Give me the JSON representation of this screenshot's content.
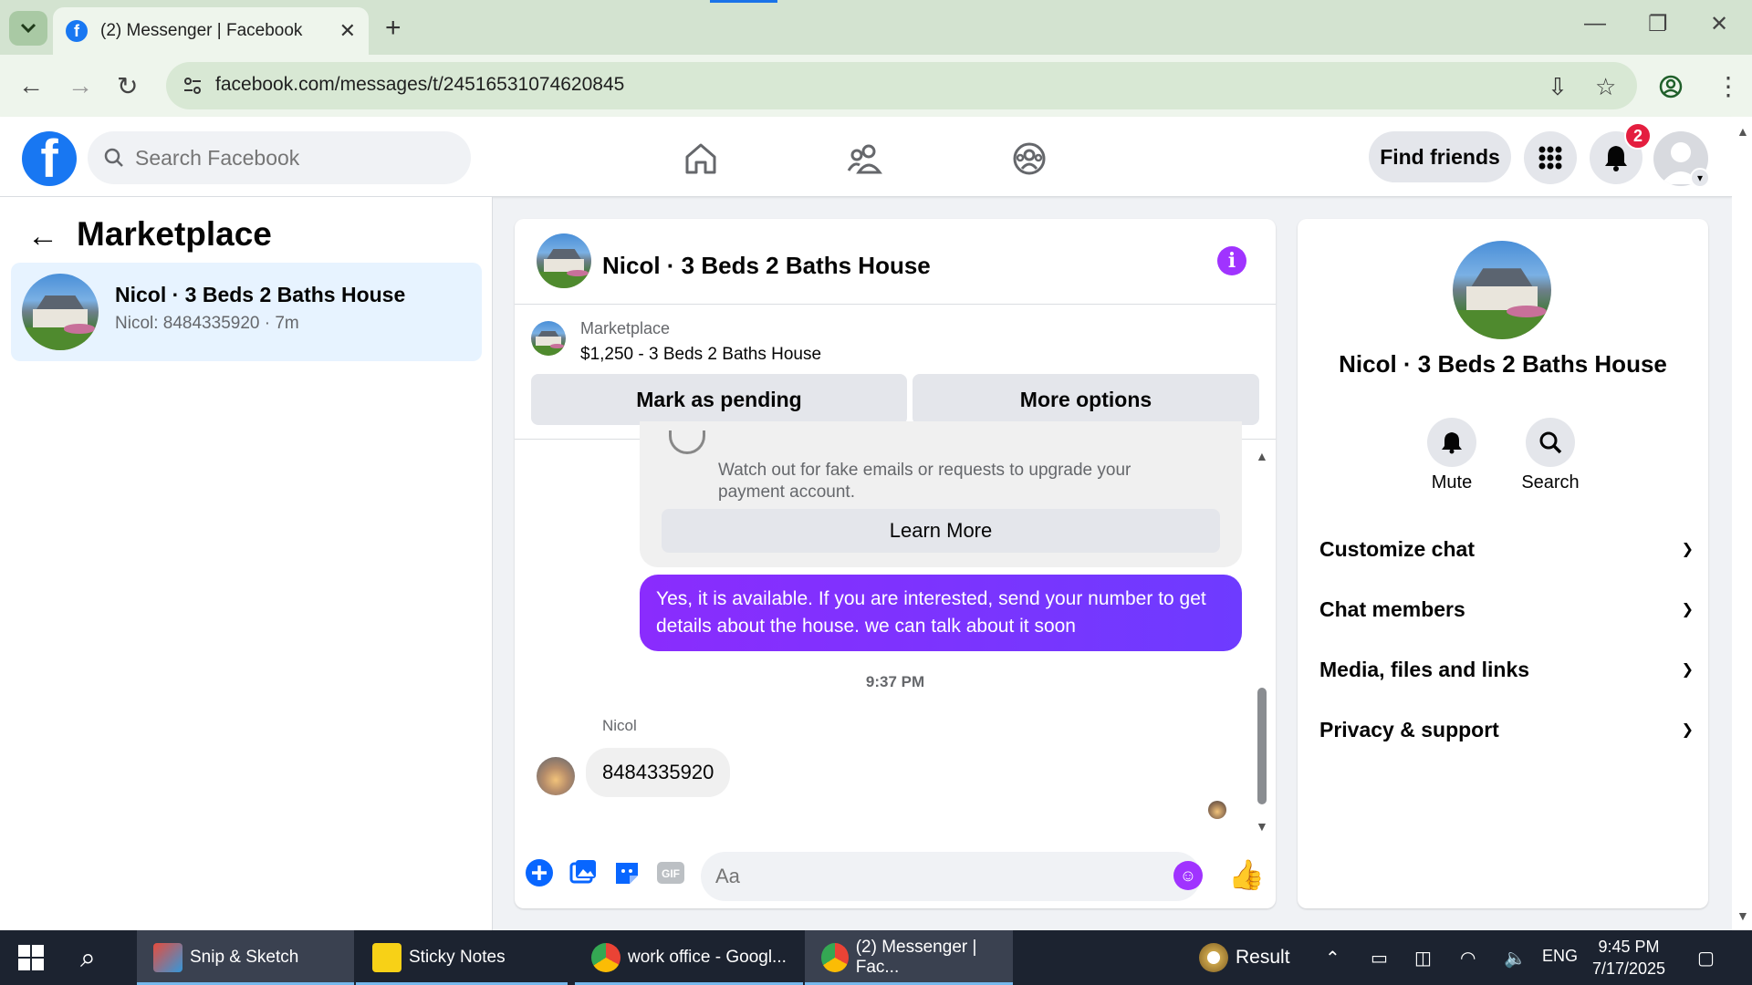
{
  "browser": {
    "tab_title": "(2) Messenger | Facebook",
    "url": "facebook.com/messages/t/24516531074620845"
  },
  "fb": {
    "search_placeholder": "Search Facebook",
    "find_friends": "Find friends",
    "notification_count": "2"
  },
  "sidebar": {
    "title": "Marketplace",
    "conversation": {
      "name": "Nicol · 3 Beds 2 Baths House",
      "preview": "Nicol: 8484335920 · 7m"
    }
  },
  "chat": {
    "title": "Nicol · 3 Beds 2 Baths House",
    "listing": {
      "source": "Marketplace",
      "price_title": "$1,250 - 3 Beds 2 Baths House",
      "mark_pending": "Mark as pending",
      "more_options": "More options"
    },
    "warning_text": "Watch out for fake emails or requests to upgrade your payment account.",
    "learn_more": "Learn More",
    "my_message": "Yes, it is available. If you are interested, send your number to get details about the house. we can talk about it soon",
    "timestamp": "9:37 PM",
    "sender_name": "Nicol",
    "their_message": "8484335920",
    "input_placeholder": "Aa"
  },
  "info_panel": {
    "name": "Nicol · 3 Beds 2 Baths House",
    "mute_label": "Mute",
    "search_label": "Search",
    "sections": [
      "Customize chat",
      "Chat members",
      "Media, files and links",
      "Privacy & support"
    ]
  },
  "taskbar": {
    "items": [
      "Snip & Sketch",
      "Sticky Notes",
      "work office - Googl...",
      "(2) Messenger | Fac..."
    ],
    "result_label": "Result",
    "lang": "ENG",
    "time": "9:45 PM",
    "date": "7/17/2025"
  },
  "colors": {
    "fb_blue": "#1877f2",
    "messenger_purple": "#a033ff",
    "badge_red": "#e41e3f"
  }
}
